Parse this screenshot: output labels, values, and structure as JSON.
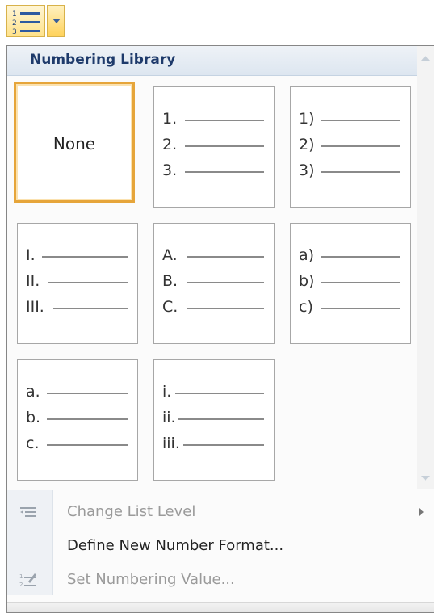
{
  "panel": {
    "header": "Numbering Library"
  },
  "tiles": [
    {
      "type": "none",
      "label": "None"
    },
    {
      "type": "list",
      "items": [
        "1.",
        "2.",
        "3."
      ]
    },
    {
      "type": "list",
      "items": [
        "1)",
        "2)",
        "3)"
      ]
    },
    {
      "type": "list",
      "items": [
        "I.",
        "II.",
        "III."
      ]
    },
    {
      "type": "list",
      "items": [
        "A.",
        "B.",
        "C."
      ]
    },
    {
      "type": "list",
      "items": [
        "a)",
        "b)",
        "c)"
      ]
    },
    {
      "type": "list",
      "items": [
        "a.",
        "b.",
        "c."
      ]
    },
    {
      "type": "list",
      "items": [
        "i.",
        "ii.",
        "iii."
      ]
    }
  ],
  "menu": {
    "change_list_level": "Change List Level",
    "define_new_format": "Define New Number Format...",
    "set_numbering_value": "Set Numbering Value..."
  },
  "icons": {
    "numbering_button": "numbering-list-icon",
    "dropdown_arrow": "chevron-down-icon",
    "change_level": "change-list-level-icon",
    "set_value": "set-numbering-value-icon"
  },
  "colors": {
    "accent": "#e6a53a",
    "header_text": "#1e3a6b",
    "disabled_text": "#9a9a9a"
  }
}
